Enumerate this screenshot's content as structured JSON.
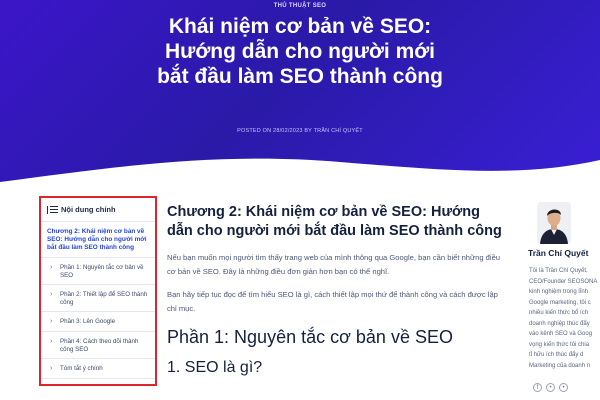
{
  "hero": {
    "category": "THỦ THUẬT SEO",
    "title": "Khái niệm cơ bản về SEO: Hướng dẫn cho người mới bắt đầu làm SEO thành công",
    "meta": "POSTED ON 28/02/2023 BY TRẦN CHÍ QUYẾT"
  },
  "toc": {
    "heading": "Nội dung chính",
    "active": "Chương 2: Khái niệm cơ bản về SEO: Hướng dẫn cho người mới bắt đầu làm SEO thành công",
    "items": [
      {
        "label": "Phần 1: Nguyên tắc cơ bản về SEO"
      },
      {
        "label": "Phần 2: Thiết lập để SEO thành công"
      },
      {
        "label": "Phần 3: Lên Google"
      },
      {
        "label": "Phần 4: Cách theo dõi thành công SEO"
      },
      {
        "label": "Tóm tắt ý chính"
      }
    ]
  },
  "article": {
    "heading": "Chương 2: Khái niệm cơ bản về SEO: Hướng dẫn cho người mới bắt đầu làm SEO thành công",
    "para1": "Nếu bạn muốn mọi người tìm thấy trang web của mình thông qua Google, bạn cần biết những điều cơ bản về SEO. Đây là những điều đơn giản hơn bạn có thể nghĩ.",
    "para2": "Bạn hãy tiếp tục đọc để tìm hiểu SEO là gì, cách thiết lập mọi thứ để thành công và cách được lập chỉ mục.",
    "section": "Phần 1: Nguyên tắc cơ bản về SEO",
    "subsection": "1. SEO là gì?"
  },
  "author": {
    "name": "Trần Chí Quyết",
    "bio": [
      "Tôi là Trần Chí Quyết,",
      "CEO/Founder SEOSONA",
      "kinh nghiệm trong lĩnh",
      "Google marketing, tôi c",
      "nhiều kiến thức bổ ích",
      "doanh nghiệp thúc đẩy",
      "vào kênh SEO và Goog",
      "vọng kiến thức tôi chia",
      "tỉ hữu ích thúc đẩy d",
      "Marketing của doanh n"
    ]
  },
  "colors": {
    "hero_bg": "#3217c4",
    "toc_border": "#e0242c",
    "toc_active": "#2744d6",
    "heading": "#14213d"
  }
}
